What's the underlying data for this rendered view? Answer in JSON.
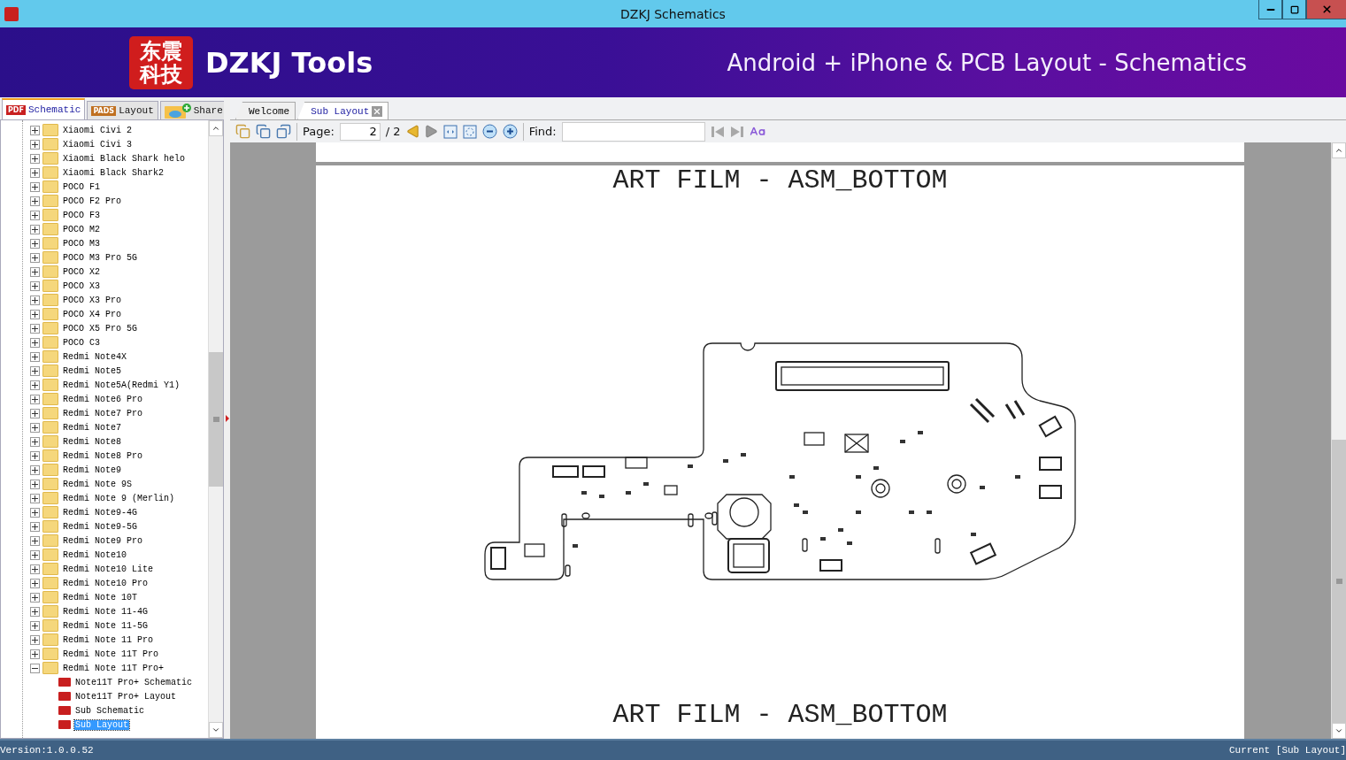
{
  "window": {
    "title": "DZKJ Schematics"
  },
  "banner": {
    "logo_lines": [
      "东震",
      "科技"
    ],
    "title": "DZKJ Tools",
    "tagline": "Android + iPhone & PCB Layout - Schematics"
  },
  "side_tabs": [
    {
      "label": "Schematic",
      "selected": true,
      "kind": "pdf",
      "badge": "PDF"
    },
    {
      "label": "Layout",
      "selected": false,
      "kind": "pads",
      "badge": "PADS"
    },
    {
      "label": "Share",
      "selected": false,
      "kind": "cloud"
    }
  ],
  "doc_tabs": [
    {
      "label": "Welcome",
      "selected": false,
      "closable": false
    },
    {
      "label": "Sub Layout",
      "selected": true,
      "closable": true
    }
  ],
  "toolbar": {
    "page_label": "Page:",
    "page_value": "2",
    "page_total": "/ 2",
    "find_label": "Find:"
  },
  "tree": [
    {
      "label": "Xiaomi Civi 2",
      "expanded": false
    },
    {
      "label": "Xiaomi Civi 3",
      "expanded": false
    },
    {
      "label": "Xiaomi Black Shark helo",
      "expanded": false
    },
    {
      "label": "Xiaomi Black Shark2",
      "expanded": false
    },
    {
      "label": "POCO F1",
      "expanded": false
    },
    {
      "label": "POCO F2 Pro",
      "expanded": false
    },
    {
      "label": "POCO F3",
      "expanded": false
    },
    {
      "label": "POCO M2",
      "expanded": false
    },
    {
      "label": "POCO M3",
      "expanded": false
    },
    {
      "label": "POCO M3 Pro 5G",
      "expanded": false
    },
    {
      "label": "POCO X2",
      "expanded": false
    },
    {
      "label": "POCO X3",
      "expanded": false
    },
    {
      "label": "POCO X3 Pro",
      "expanded": false
    },
    {
      "label": "POCO X4 Pro",
      "expanded": false
    },
    {
      "label": "POCO X5 Pro 5G",
      "expanded": false
    },
    {
      "label": "POCO C3",
      "expanded": false
    },
    {
      "label": "Redmi Note4X",
      "expanded": false
    },
    {
      "label": "Redmi Note5",
      "expanded": false
    },
    {
      "label": "Redmi Note5A(Redmi Y1)",
      "expanded": false
    },
    {
      "label": "Redmi Note6 Pro",
      "expanded": false
    },
    {
      "label": "Redmi Note7 Pro",
      "expanded": false
    },
    {
      "label": "Redmi Note7",
      "expanded": false
    },
    {
      "label": "Redmi Note8",
      "expanded": false
    },
    {
      "label": "Redmi Note8 Pro",
      "expanded": false
    },
    {
      "label": "Redmi Note9",
      "expanded": false
    },
    {
      "label": "Redmi Note 9S",
      "expanded": false
    },
    {
      "label": "Redmi Note 9 (Merlin)",
      "expanded": false
    },
    {
      "label": "Redmi Note9-4G",
      "expanded": false
    },
    {
      "label": "Redmi Note9-5G",
      "expanded": false
    },
    {
      "label": "Redmi Note9 Pro",
      "expanded": false
    },
    {
      "label": "Redmi Note10",
      "expanded": false
    },
    {
      "label": "Redmi Note10 Lite",
      "expanded": false
    },
    {
      "label": "Redmi Note10 Pro",
      "expanded": false
    },
    {
      "label": "Redmi Note 10T",
      "expanded": false
    },
    {
      "label": "Redmi Note 11-4G",
      "expanded": false
    },
    {
      "label": "Redmi Note 11-5G",
      "expanded": false
    },
    {
      "label": "Redmi Note 11 Pro",
      "expanded": false
    },
    {
      "label": "Redmi Note 11T Pro",
      "expanded": false
    },
    {
      "label": "Redmi Note 11T Pro+",
      "expanded": true,
      "children": [
        {
          "label": "Note11T Pro+ Schematic",
          "selected": false
        },
        {
          "label": "Note11T Pro+ Layout",
          "selected": false
        },
        {
          "label": "Sub Schematic",
          "selected": false
        },
        {
          "label": "Sub Layout",
          "selected": true
        }
      ]
    }
  ],
  "document": {
    "heading_top": "ART FILM - ASM_BOTTOM",
    "heading_bottom": "ART FILM - ASM_BOTTOM"
  },
  "status_bar": {
    "version": "Version:1.0.0.52",
    "current": "Current [Sub Layout]"
  }
}
